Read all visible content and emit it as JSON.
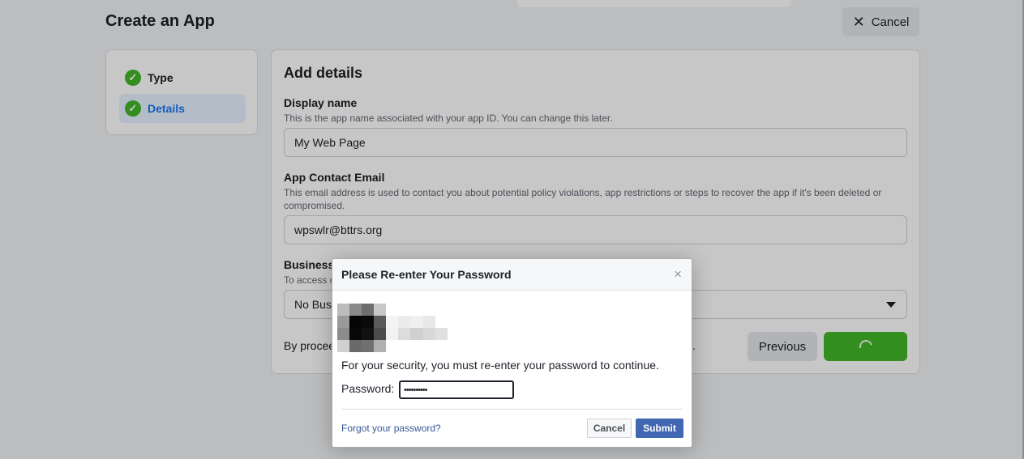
{
  "header": {
    "title": "Create an App",
    "cancel_label": "Cancel",
    "cancel_icon": "close-icon",
    "search_icon": "search-icon"
  },
  "steps": {
    "items": [
      {
        "label": "Type",
        "status": "complete",
        "icon": "check-circle-icon",
        "active": false
      },
      {
        "label": "Details",
        "status": "complete",
        "icon": "check-circle-icon",
        "active": true
      }
    ]
  },
  "form": {
    "title": "Add details",
    "display_name": {
      "label": "Display name",
      "help": "This is the app name associated with your app ID. You can change this later.",
      "value": "My Web Page"
    },
    "contact_email": {
      "label": "App Contact Email",
      "help": "This email address is used to contact you about potential policy violations, app restrictions or steps to recover the app if it's been deleted or compromised.",
      "value": "wpswlr@bttrs.org"
    },
    "business_account": {
      "label": "Business",
      "help": "To access c",
      "value": "No Busi"
    },
    "terms_text": "By procee",
    "terms_tail": "..",
    "previous_label": "Previous",
    "create_state": "loading"
  },
  "dialog": {
    "title": "Please Re-enter Your Password",
    "close_icon": "close-icon",
    "message": "For your security, you must re-enter your password to continue.",
    "password_label": "Password:",
    "password_value": "••••••••••",
    "forgot_link": "Forgot your password?",
    "cancel_label": "Cancel",
    "submit_label": "Submit",
    "avatar_pixels": [
      "#bcbcbc",
      "#8a8a8a",
      "#6e6e6e",
      "#c8c8c8",
      "#9a9a9a",
      "#050505",
      "#0a0a0a",
      "#5a5a5a",
      "#8c8c8c",
      "#080808",
      "#111111",
      "#4c4c4c",
      "#d0d0d0",
      "#6a6a6a",
      "#707070",
      "#b0b0b0"
    ],
    "name_pixels": [
      "#f4f4f4",
      "#ececec",
      "#f0f0f0",
      "#e8e8e8",
      "#ffffff",
      "#f2f2f2",
      "#dcdcdc",
      "#d0d0d0",
      "#d8d8d8",
      "#e0e0e0"
    ]
  },
  "colors": {
    "accent_blue": "#1877f2",
    "success_green": "#42b72a",
    "dialog_button_blue": "#4267b2",
    "link_blue": "#385898"
  }
}
